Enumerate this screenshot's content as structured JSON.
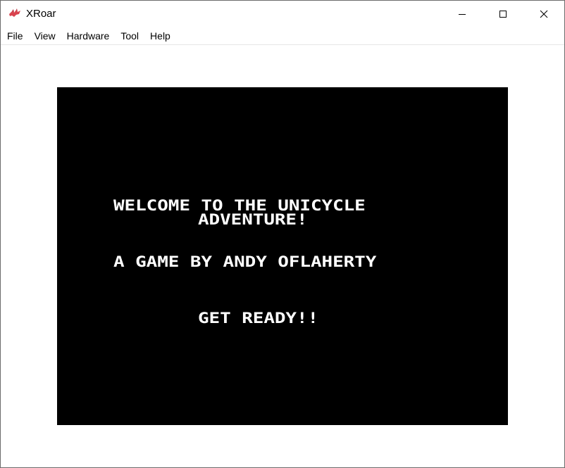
{
  "window": {
    "title": "XRoar",
    "app_icon": "xroar-dragon-icon",
    "controls": {
      "minimize": "minimize-icon",
      "maximize": "maximize-icon",
      "close": "close-icon"
    }
  },
  "menubar": {
    "items": [
      "File",
      "View",
      "Hardware",
      "Tool",
      "Help"
    ]
  },
  "screen": {
    "background": "#000000",
    "text_color": "#ffffff",
    "lines": [
      "WELCOME TO THE UNICYCLE",
      "ADVENTURE!",
      "A GAME BY ANDY OFLAHERTY",
      "GET READY!!"
    ]
  }
}
